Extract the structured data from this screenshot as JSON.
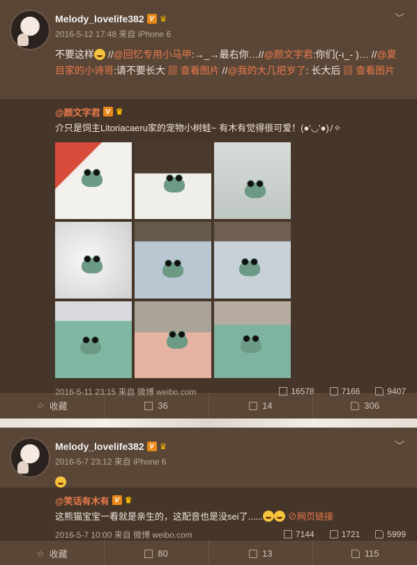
{
  "post1": {
    "username": "Melody_lovelife382",
    "time": "2016-5-12 17:48 来自 iPhone 6",
    "text_a": "不要这样",
    "text_b": " //",
    "m1": "@回忆专用小马甲",
    "t1": ":→_→最右你…//",
    "m2": "@颜文字君",
    "t2": ":你们(-ı_- )… //",
    "m3": "@夏目家的小诗哥",
    "t3": ":请不要长大 ",
    "img_link": "查看图片",
    "t4": " //",
    "m4": "@我的大几把岁了",
    "t5": ": 长大后 ",
    "img_link2": "查看图片",
    "repost": {
      "username": "@颜文字君",
      "text": "介只是饲主Litoriacaeru家的宠物小树蛙~ 有木有觉得很可爱！(●'◡'●)ﾉ✧",
      "time": "2016-5-11 23:15 来自 微博 weibo.com",
      "shares": "16578",
      "comments": "7166",
      "likes": "9407"
    },
    "actions": {
      "fav": "收藏",
      "share": "36",
      "comment": "14",
      "like": "306"
    }
  },
  "post2": {
    "username": "Melody_lovelife382",
    "time": "2016-5-7 23:12 来自 iPhone 6",
    "repost": {
      "username": "@笑话有木有",
      "text": "这熊猫宝宝一看就是亲生的，这配音也是没sei了......",
      "weblink": "网页链接",
      "time": "2016-5-7 10:00 来自 微博 weibo.com",
      "shares": "7144",
      "comments": "1721",
      "likes": "5999"
    },
    "actions": {
      "fav": "收藏",
      "share": "80",
      "comment": "13",
      "like": "115"
    }
  },
  "colors": {
    "background": "#5a4637",
    "repost_bg": "#463629",
    "accent": "#ea7a4b",
    "vip": "#e8891b"
  }
}
